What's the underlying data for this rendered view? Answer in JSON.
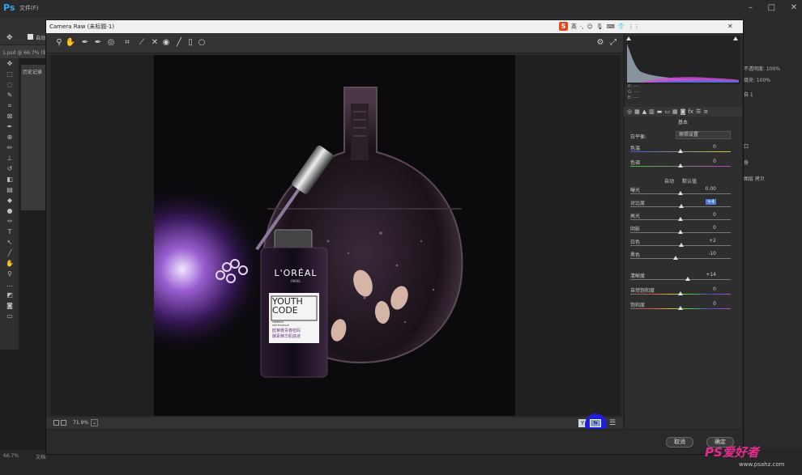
{
  "ps": {
    "menu_text": "文件(F)",
    "option_text": "自动",
    "doc_tab": "1.psd @ 66.7% (背",
    "history_title": "历史记录",
    "right_panel": {
      "opacity_label": "不透明度: 100%",
      "fill_label": "填充: 100%",
      "opacity2_label": "不透明度: 100%",
      "fill2_label": "填充: 100%",
      "layer1": "自 1",
      "layer2": "口",
      "layer3": "身",
      "layer4": "图层 拷贝"
    },
    "zoom_status": "66.7%",
    "doc_status": "文档:"
  },
  "watermark": {
    "text": "PS爱好者",
    "url": "www.psahz.com"
  },
  "camera_raw": {
    "title": "Camera Raw (未标题-1)",
    "ime_label": "英",
    "zoom_level": "71.9%",
    "cancel_label": "取消",
    "ok_label": "确定",
    "compare_label": "Y",
    "rgb_readout": [
      "R: ----",
      "G: ----",
      "B: ----"
    ],
    "section_title": "基本",
    "white_balance_label": "白平衡:",
    "white_balance_value": "原照设置",
    "auto_label": "自动",
    "default_label": "默认值",
    "sliders": {
      "temperature": {
        "label": "色温",
        "value": "0"
      },
      "tint": {
        "label": "色调",
        "value": "0"
      },
      "exposure": {
        "label": "曝光",
        "value": "0.00"
      },
      "contrast": {
        "label": "对比度",
        "value": "+4"
      },
      "highlights": {
        "label": "高光",
        "value": "0"
      },
      "shadows": {
        "label": "阴影",
        "value": "0"
      },
      "whites": {
        "label": "白色",
        "value": "+2"
      },
      "blacks": {
        "label": "黑色",
        "value": "-10"
      },
      "clarity": {
        "label": "清晰度",
        "value": "+14"
      },
      "vibrance": {
        "label": "自然饱和度",
        "value": "0"
      },
      "saturation": {
        "label": "饱和度",
        "value": "0"
      }
    }
  },
  "product": {
    "brand": "L'ORÉAL",
    "brand_sub": "PARIS",
    "name_line1": "YOUTH",
    "name_line2": "CODE",
    "subtitle1": "FERMENT",
    "subtitle2": "PRE-ESSENCE",
    "cn_line1": "欧莱雅青春密码",
    "cn_line2": "酵素精华肌底液"
  },
  "colors": {
    "accent_blue": "#1f1fd6",
    "brand_pink": "#e62d8e",
    "ps_blue": "#31a8ff"
  }
}
